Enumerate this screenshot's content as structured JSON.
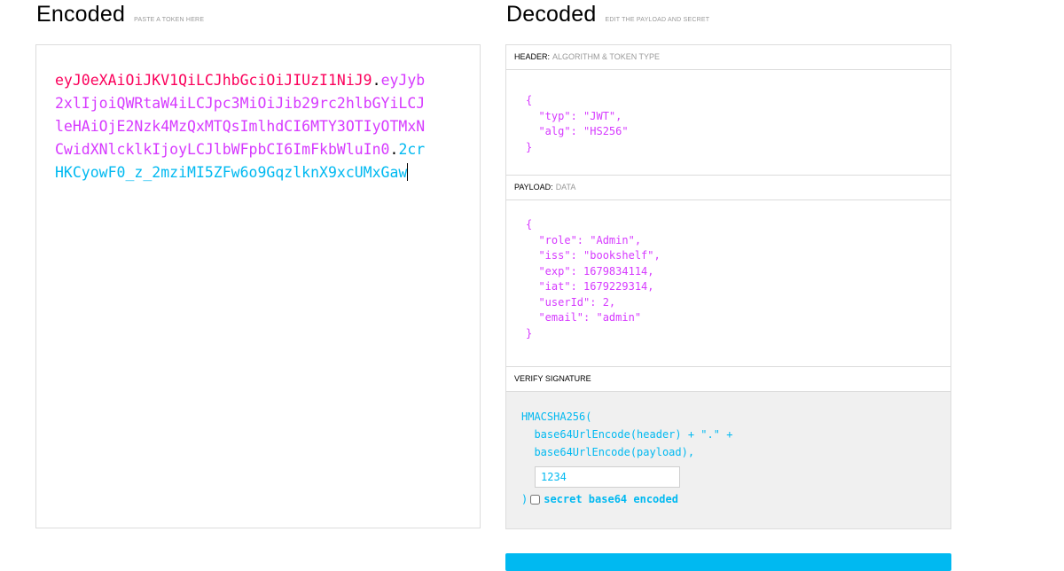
{
  "encoded": {
    "title": "Encoded",
    "subtitle": "PASTE A TOKEN HERE",
    "token_header": "eyJ0eXAiOiJKV1QiLCJhbGciOiJIUzI1NiJ9",
    "token_payload": "eyJyb2xlIjoiQWRtaW4iLCJpc3MiOiJib29rc2hlbGYiLCJleHAiOjE2Nzk4MzQxMTQsImlhdCI6MTY3OTIyOTMxNCwidXNlcklkIjoyLCJlbWFpbCI6ImFkbWluIn0",
    "token_signature": "2crHKCyowF0_z_2mziMI5ZFw6o9GqzlknX9xcUMxGaw",
    "dot": "."
  },
  "decoded": {
    "title": "Decoded",
    "subtitle": "EDIT THE PAYLOAD AND SECRET",
    "header_section": {
      "label": "HEADER:",
      "sublabel": "ALGORITHM & TOKEN TYPE",
      "json": "{\n  \"typ\": \"JWT\",\n  \"alg\": \"HS256\"\n}"
    },
    "payload_section": {
      "label": "PAYLOAD:",
      "sublabel": "DATA",
      "json": "{\n  \"role\": \"Admin\",\n  \"iss\": \"bookshelf\",\n  \"exp\": 1679834114,\n  \"iat\": 1679229314,\n  \"userId\": 2,\n  \"email\": \"admin\"\n}"
    },
    "signature_section": {
      "label": "VERIFY SIGNATURE",
      "line1": "HMACSHA256(",
      "line2": "  base64UrlEncode(header) + \".\" +",
      "line3": "  base64UrlEncode(payload),",
      "secret_value": "1234",
      "close": ")",
      "base64_label": "secret base64 encoded",
      "base64_checked": false
    }
  },
  "colors": {
    "header": "#fb015b",
    "payload": "#d63aff",
    "signature": "#00b9f1"
  }
}
